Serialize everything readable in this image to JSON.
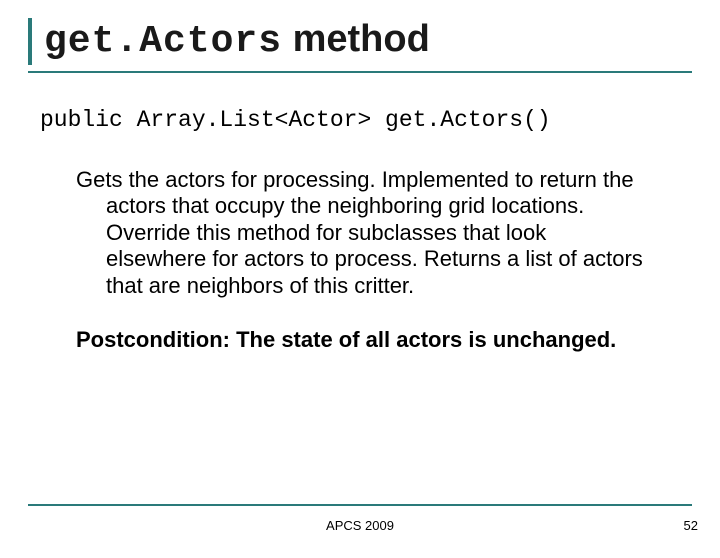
{
  "title": {
    "code_part": "get.Actors",
    "text_part": " method"
  },
  "signature": "public Array.List<Actor> get.Actors()",
  "description": "Gets the actors for processing. Implemented to return the actors that occupy the neighboring grid locations. Override this method for subclasses that look elsewhere for actors to process. Returns a list of actors that are neighbors of this critter.",
  "postcondition": "Postcondition: The state of all actors is unchanged.",
  "footer": {
    "center": "APCS 2009",
    "page": "52"
  }
}
